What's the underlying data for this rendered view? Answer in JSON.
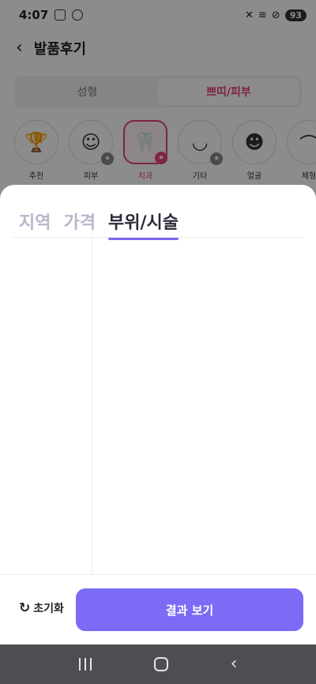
{
  "status": {
    "time": "4:07",
    "battery": "93"
  },
  "header": {
    "title": "발품후기",
    "back_icon": "chevron-left-icon"
  },
  "segment": {
    "tabs": [
      {
        "label": "성형"
      },
      {
        "label": "쁘띠/피부"
      }
    ],
    "active_index": 1
  },
  "categories": [
    {
      "label": "추천",
      "icon": "trophy-icon"
    },
    {
      "label": "피부",
      "icon": "face-skin-icon"
    },
    {
      "label": "치과",
      "icon": "tooth-icon"
    },
    {
      "label": "기타",
      "icon": "eye-icon"
    },
    {
      "label": "얼굴",
      "icon": "face-icon"
    },
    {
      "label": "체형",
      "icon": "body-icon"
    }
  ],
  "active_category": "치과",
  "sheet": {
    "tabs": [
      {
        "label": "지역"
      },
      {
        "label": "가격"
      },
      {
        "label": "부위/시술"
      }
    ],
    "active_tab": "부위/시술",
    "reset_label": "초기화",
    "result_button_label": "결과 보기"
  },
  "colors": {
    "accent_purple": "#7b6bf5",
    "accent_pink": "#e8427c"
  }
}
